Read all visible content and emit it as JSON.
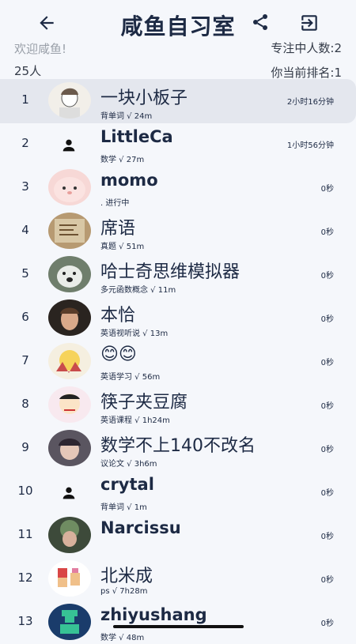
{
  "header": {
    "title": "咸鱼自习室",
    "back_icon": "arrow-left-icon",
    "share_icon": "share-icon",
    "exit_icon": "exit-icon"
  },
  "info": {
    "welcome": "欢迎咸鱼!",
    "focus_count": "专注中人数:2",
    "people": "25人",
    "rank": "你当前排名:1"
  },
  "rows": [
    {
      "rank": "1",
      "name": "一块小板子",
      "sub": "背单词 √ 24m",
      "time": "2小时16分钟",
      "avatar": "photo"
    },
    {
      "rank": "2",
      "name": "LittleCa",
      "sub": "数学 √ 27m",
      "time": "1小时56分钟",
      "avatar": "person-icon"
    },
    {
      "rank": "3",
      "name": "momo",
      "sub": ". 进行中",
      "time": "0秒",
      "avatar": "photo"
    },
    {
      "rank": "4",
      "name": "席语",
      "sub": "真题 √ 51m",
      "time": "0秒",
      "avatar": "photo"
    },
    {
      "rank": "5",
      "name": "哈士奇思维模拟器",
      "sub": "多元函数概念 √ 11m",
      "time": "0秒",
      "avatar": "photo"
    },
    {
      "rank": "6",
      "name": "本恰",
      "sub": "英语视听说 √ 13m",
      "time": "0秒",
      "avatar": "photo"
    },
    {
      "rank": "7",
      "name": "😊😊",
      "sub": "英语学习 √ 56m",
      "time": "0秒",
      "avatar": "photo"
    },
    {
      "rank": "8",
      "name": "筷子夹豆腐",
      "sub": "英语课程 √ 1h24m",
      "time": "0秒",
      "avatar": "photo"
    },
    {
      "rank": "9",
      "name": "数学不上140不改名",
      "sub": "议论文 √ 3h6m",
      "time": "0秒",
      "avatar": "photo"
    },
    {
      "rank": "10",
      "name": "crytal",
      "sub": "背单词 √ 1m",
      "time": "0秒",
      "avatar": "person-icon"
    },
    {
      "rank": "11",
      "name": "Narcissu",
      "sub": "",
      "time": "0秒",
      "avatar": "photo"
    },
    {
      "rank": "12",
      "name": "北米成",
      "sub": "ps √ 7h28m",
      "time": "0秒",
      "avatar": "photo"
    },
    {
      "rank": "13",
      "name": "zhiyushang",
      "sub": "数学 √ 48m",
      "time": "0秒",
      "avatar": "photo"
    }
  ],
  "colors": {
    "background": "#f5f7fb",
    "highlight": "#e4e7ee",
    "text": "#1d2a44"
  }
}
